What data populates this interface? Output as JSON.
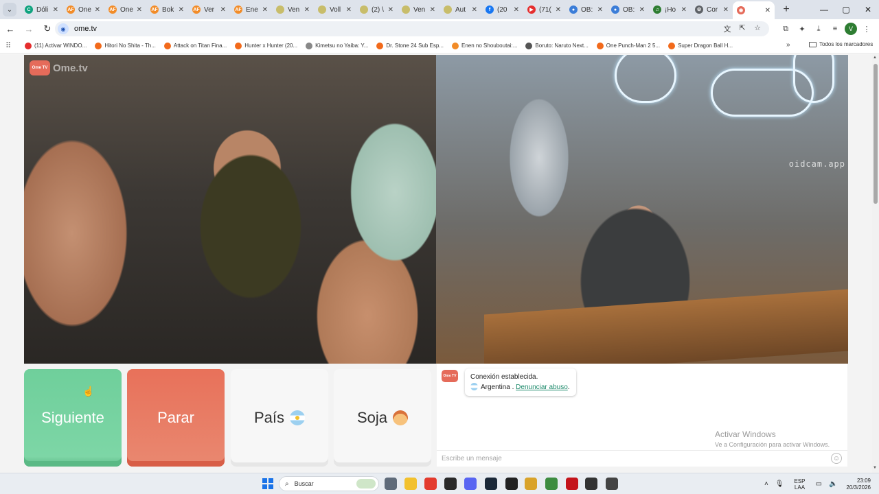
{
  "browser": {
    "tabs": [
      {
        "title": "Dóli",
        "color": "#10a37f",
        "glyph": "C"
      },
      {
        "title": "One",
        "color": "#f28c28",
        "glyph": "AF"
      },
      {
        "title": "One",
        "color": "#f28c28",
        "glyph": "AF"
      },
      {
        "title": "Bok",
        "color": "#f28c28",
        "glyph": "AF"
      },
      {
        "title": "Ver",
        "color": "#f28c28",
        "glyph": "AF"
      },
      {
        "title": "Ene",
        "color": "#f28c28",
        "glyph": "AF"
      },
      {
        "title": "Ven",
        "color": "#c8bd6a",
        "glyph": ""
      },
      {
        "title": "Voll",
        "color": "#c8bd6a",
        "glyph": ""
      },
      {
        "title": "(2) \\",
        "color": "#c8bd6a",
        "glyph": ""
      },
      {
        "title": "Ven",
        "color": "#c8bd6a",
        "glyph": ""
      },
      {
        "title": "Aut",
        "color": "#c8bd6a",
        "glyph": ""
      },
      {
        "title": "(20",
        "color": "#1877f2",
        "glyph": "f"
      },
      {
        "title": "(71(",
        "color": "#e52d2d",
        "glyph": "▶"
      },
      {
        "title": "OB:",
        "color": "#3b7dd8",
        "glyph": "●"
      },
      {
        "title": "OB:",
        "color": "#3b7dd8",
        "glyph": "●"
      },
      {
        "title": "¡Ho",
        "color": "#2e7d32",
        "glyph": "♫"
      },
      {
        "title": "Cor",
        "color": "#5f6368",
        "glyph": "⚙"
      },
      {
        "title": "",
        "color": "#e56b5a",
        "glyph": "◉",
        "active": true
      }
    ],
    "new_tab": "+",
    "window_controls": [
      "—",
      "▢",
      "✕"
    ],
    "url": "ome.tv",
    "bookmarks": [
      {
        "label": "(11) Activar WINDO...",
        "color": "#e52d2d"
      },
      {
        "label": "Hitori No Shita - Th...",
        "color": "#f26a1b"
      },
      {
        "label": "Attack on Titan Fina...",
        "color": "#f26a1b"
      },
      {
        "label": "Hunter x Hunter (20...",
        "color": "#f26a1b"
      },
      {
        "label": "Kimetsu no Yaiba: Y...",
        "color": "#888888"
      },
      {
        "label": "Dr. Stone 24 Sub Esp...",
        "color": "#f26a1b"
      },
      {
        "label": "Enen no Shouboutai:...",
        "color": "#f28c28"
      },
      {
        "label": "Boruto: Naruto Next...",
        "color": "#555555"
      },
      {
        "label": "One Punch-Man 2 5...",
        "color": "#f26a1b"
      },
      {
        "label": "Super Dragon Ball H...",
        "color": "#f26a1b"
      }
    ],
    "bookmarks_more": "»",
    "bookmarks_folder": "Todos los marcadores"
  },
  "page": {
    "logo_badge": "Ome TV",
    "logo_text": "Ome.tv",
    "camera_watermark": "oidcam.app",
    "buttons": {
      "next": "Siguiente",
      "stop": "Parar",
      "country": "País",
      "gender": "Soja"
    },
    "chat": {
      "logo": "Ome TV",
      "connection": "Conexión establecida.",
      "country": "Argentina",
      "separator": " . ",
      "report": "Denunciar abuso",
      "report_end": ".",
      "placeholder": "Escribe un mensaje",
      "emoji": "☺"
    },
    "activate_windows": {
      "title": "Activar Windows",
      "subtitle": "Ve a Configuración para activar Windows."
    }
  },
  "taskbar": {
    "search_placeholder": "Buscar",
    "lang_top": "ESP",
    "lang_bottom": "LAA",
    "time": "23:09",
    "date": "20/3/2026",
    "apps": [
      {
        "name": "task-view",
        "color": "#5f6b7a"
      },
      {
        "name": "file-explorer",
        "color": "#f2c12e"
      },
      {
        "name": "chrome",
        "color": "#e33b2e"
      },
      {
        "name": "epic-games",
        "color": "#2a2a2a"
      },
      {
        "name": "discord",
        "color": "#5865f2"
      },
      {
        "name": "steam",
        "color": "#1b2838"
      },
      {
        "name": "clock-app",
        "color": "#222222"
      },
      {
        "name": "store-app",
        "color": "#d9a32a"
      },
      {
        "name": "minecraft",
        "color": "#3d8c40"
      },
      {
        "name": "red-app",
        "color": "#c4141b"
      },
      {
        "name": "obs",
        "color": "#333333"
      },
      {
        "name": "maps-app",
        "color": "#444444"
      }
    ]
  }
}
